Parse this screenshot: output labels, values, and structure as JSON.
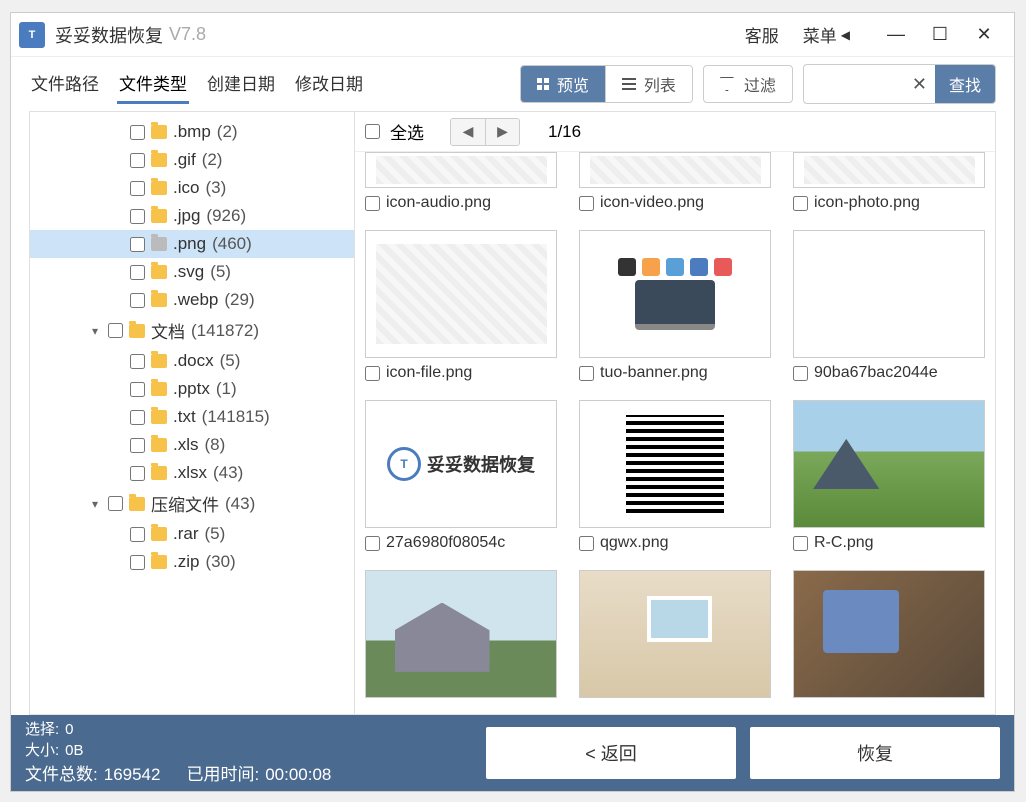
{
  "titlebar": {
    "app_name": "妥妥数据恢复",
    "version": "V7.8",
    "support": "客服",
    "menu": "菜单"
  },
  "tabs": {
    "path": "文件路径",
    "type": "文件类型",
    "created": "创建日期",
    "modified": "修改日期"
  },
  "toolbar": {
    "preview": "预览",
    "list": "列表",
    "filter": "过滤",
    "search": "查找"
  },
  "selectall": "全选",
  "pager": "1/16",
  "tree": [
    {
      "ext": ".bmp",
      "count": "(2)"
    },
    {
      "ext": ".gif",
      "count": "(2)"
    },
    {
      "ext": ".ico",
      "count": "(3)"
    },
    {
      "ext": ".jpg",
      "count": "(926)"
    },
    {
      "ext": ".png",
      "count": "(460)",
      "selected": true
    },
    {
      "ext": ".svg",
      "count": "(5)"
    },
    {
      "ext": ".webp",
      "count": "(29)"
    }
  ],
  "tree_docs": {
    "label": "文档",
    "count": "(141872)"
  },
  "tree_docs_children": [
    {
      "ext": ".docx",
      "count": "(5)"
    },
    {
      "ext": ".pptx",
      "count": "(1)"
    },
    {
      "ext": ".txt",
      "count": "(141815)"
    },
    {
      "ext": ".xls",
      "count": "(8)"
    },
    {
      "ext": ".xlsx",
      "count": "(43)"
    }
  ],
  "tree_zip": {
    "label": "压缩文件",
    "count": "(43)"
  },
  "tree_zip_children": [
    {
      "ext": ".rar",
      "count": "(5)"
    },
    {
      "ext": ".zip",
      "count": "(30)"
    }
  ],
  "thumbs": [
    {
      "name": "icon-audio.png",
      "cut": true
    },
    {
      "name": "icon-video.png",
      "cut": true
    },
    {
      "name": "icon-photo.png",
      "cut": true
    },
    {
      "name": "icon-file.png"
    },
    {
      "name": "tuo-banner.png"
    },
    {
      "name": "90ba67bac2044e"
    },
    {
      "name": "27a6980f08054c"
    },
    {
      "name": "qgwx.png"
    },
    {
      "name": "R-C.png"
    },
    {
      "name": ""
    },
    {
      "name": ""
    },
    {
      "name": ""
    }
  ],
  "logo_text": "妥妥数据恢复",
  "footer": {
    "sel_label": "选择:",
    "sel_val": "0",
    "size_label": "大小:",
    "size_val": "0B",
    "total_label": "文件总数:",
    "total_val": "169542",
    "time_label": "已用时间:",
    "time_val": "00:00:08",
    "back": "< 返回",
    "recover": "恢复"
  }
}
